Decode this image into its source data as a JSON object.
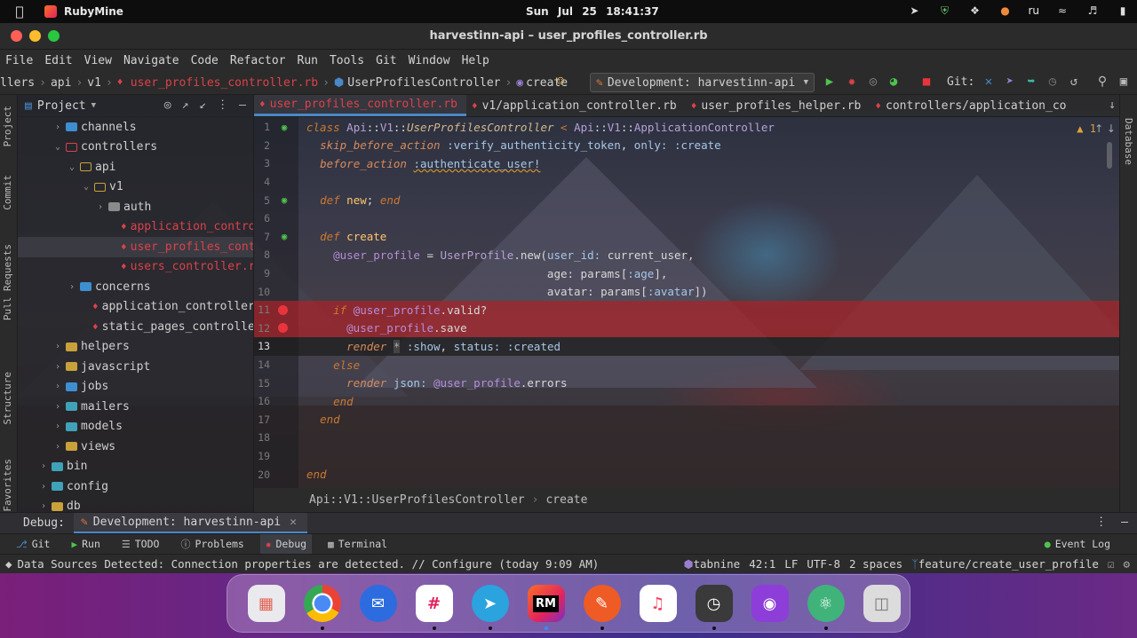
{
  "menubar": {
    "app_name": "RubyMine",
    "clock": "Sun Jul 25  18:41:37",
    "lang": "ru"
  },
  "window": {
    "title": "harvestinn-api – user_profiles_controller.rb"
  },
  "ide_menu": [
    "File",
    "Edit",
    "View",
    "Navigate",
    "Code",
    "Refactor",
    "Run",
    "Tools",
    "Git",
    "Window",
    "Help"
  ],
  "navbar": {
    "crumbs": [
      "llers",
      "api",
      "v1",
      "user_profiles_controller.rb",
      "UserProfilesController",
      "create"
    ],
    "run_config": "Development: harvestinn-api",
    "git_label": "Git:"
  },
  "project": {
    "header": "Project",
    "tree": [
      {
        "label": "channels",
        "indent": 1
      },
      {
        "label": "controllers",
        "indent": 1
      },
      {
        "label": "api",
        "indent": 2
      },
      {
        "label": "v1",
        "indent": 3
      },
      {
        "label": "auth",
        "indent": 4
      },
      {
        "label": "application_contro",
        "indent": 5
      },
      {
        "label": "user_profiles_contr",
        "indent": 5
      },
      {
        "label": "users_controller.rb",
        "indent": 5
      },
      {
        "label": "concerns",
        "indent": 2
      },
      {
        "label": "application_controller.",
        "indent": 3
      },
      {
        "label": "static_pages_controller.",
        "indent": 3
      },
      {
        "label": "helpers",
        "indent": 1
      },
      {
        "label": "javascript",
        "indent": 1
      },
      {
        "label": "jobs",
        "indent": 1
      },
      {
        "label": "mailers",
        "indent": 1
      },
      {
        "label": "models",
        "indent": 1
      },
      {
        "label": "views",
        "indent": 1
      },
      {
        "label": "bin",
        "indent": 0
      },
      {
        "label": "config",
        "indent": 0
      },
      {
        "label": "db",
        "indent": 0
      }
    ]
  },
  "tabs": [
    "user_profiles_controller.rb",
    "v1/application_controller.rb",
    "user_profiles_helper.rb",
    "controllers/application_co"
  ],
  "editor": {
    "line_numbers": [
      "1",
      "2",
      "3",
      "4",
      "5",
      "6",
      "7",
      "8",
      "9",
      "10",
      "11",
      "12",
      "13",
      "14",
      "15",
      "16",
      "17",
      "18",
      "19",
      "20"
    ],
    "warning_count": "1",
    "breadcrumb": [
      "Api::V1::UserProfilesController",
      "create"
    ]
  },
  "side_tabs": {
    "left": [
      "Project",
      "Commit",
      "Pull Requests",
      "Structure",
      "Favorites"
    ],
    "right": [
      "Database"
    ]
  },
  "debug": {
    "label": "Debug:",
    "session": "Development: harvestinn-api"
  },
  "tool_windows": [
    "Git",
    "Run",
    "TODO",
    "Problems",
    "Debug",
    "Terminal"
  ],
  "event_log": "Event Log",
  "status": {
    "message": "Data Sources Detected: Connection properties are detected. // Configure (today 9:09 AM)",
    "tabnine": "tabnine",
    "position": "42:1",
    "line_sep": "LF",
    "encoding": "UTF-8",
    "indent": "2 spaces",
    "branch": "feature/create_user_profile"
  },
  "dock": [
    "launchpad",
    "chrome",
    "mail",
    "slack",
    "telegram",
    "rubymine",
    "postman",
    "music",
    "clock",
    "podcasts",
    "atom",
    "trash"
  ],
  "colors": {
    "accent": "#4a88c7",
    "ruby": "#d9424a",
    "breakpoint": "#e8353d"
  }
}
